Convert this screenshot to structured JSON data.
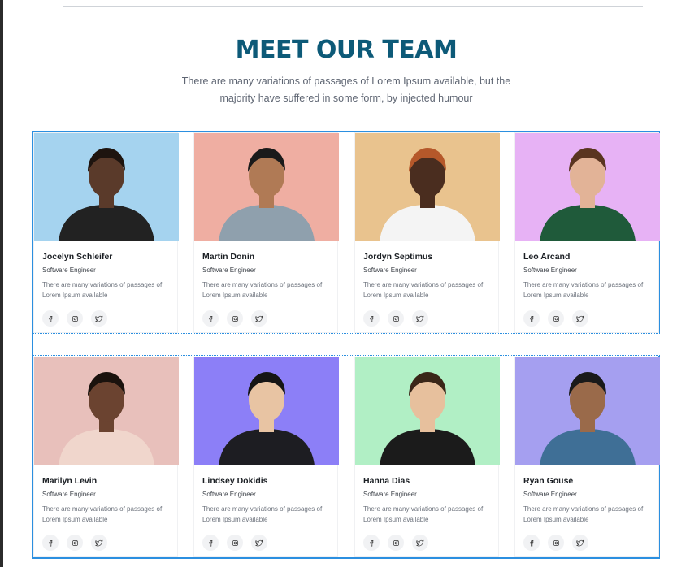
{
  "section": {
    "title": "MEET OUR TEAM",
    "subtitle": "There are many variations of passages of Lorem Ipsum available, but the majority have suffered in some form, by injected humour"
  },
  "colors": {
    "title": "#0d5a78",
    "selection_outline": "#2b8fe0"
  },
  "social_icons": [
    "facebook-icon",
    "instagram-icon",
    "twitter-icon"
  ],
  "team": [
    {
      "name": "Jocelyn Schleifer",
      "role": "Software Engineer",
      "desc": "There are many variations of passages of Lorem Ipsum available",
      "photo_bg": "#a5d3ef"
    },
    {
      "name": "Martin Donin",
      "role": "Software Engineer",
      "desc": "There are many variations of passages of Lorem Ipsum available",
      "photo_bg": "#efaea2"
    },
    {
      "name": "Jordyn Septimus",
      "role": "Software Engineer",
      "desc": "There are many variations of passages of Lorem Ipsum available",
      "photo_bg": "#e9c38e"
    },
    {
      "name": "Leo Arcand",
      "role": "Software Engineer",
      "desc": "There are many variations of passages of Lorem Ipsum available",
      "photo_bg": "#e7b2f5"
    },
    {
      "name": "Marilyn Levin",
      "role": "Software Engineer",
      "desc": "There are many variations of passages of Lorem Ipsum available",
      "photo_bg": "#e8c0bb"
    },
    {
      "name": "Lindsey Dokidis",
      "role": "Software Engineer",
      "desc": "There are many variations of passages of Lorem Ipsum available",
      "photo_bg": "#8c7ff7"
    },
    {
      "name": "Hanna Dias",
      "role": "Software Engineer",
      "desc": "There are many variations of passages of Lorem Ipsum available",
      "photo_bg": "#b1efc5"
    },
    {
      "name": "Ryan Gouse",
      "role": "Software Engineer",
      "desc": "There are many variations of passages of Lorem Ipsum available",
      "photo_bg": "#a59ff0"
    }
  ]
}
